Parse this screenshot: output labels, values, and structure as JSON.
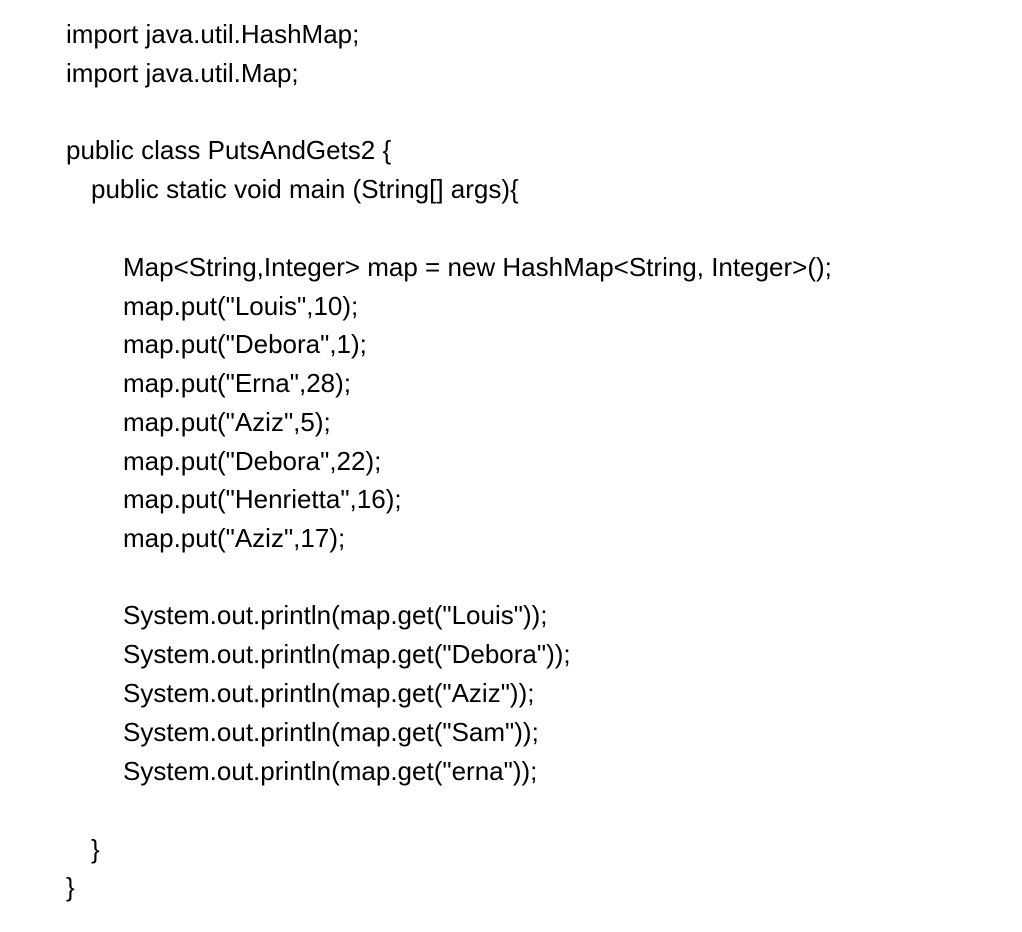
{
  "code": {
    "imports": [
      "import java.util.HashMap;",
      "import java.util.Map;"
    ],
    "class_decl": "public class PutsAndGets2 {",
    "method_decl": "public static void main (String[] args){",
    "map_decl": "Map<String,Integer> map = new HashMap<String, Integer>();",
    "puts": [
      "map.put(\"Louis\",10);",
      "map.put(\"Debora\",1);",
      "map.put(\"Erna\",28);",
      "map.put(\"Aziz\",5);",
      "map.put(\"Debora\",22);",
      "map.put(\"Henrietta\",16);",
      "map.put(\"Aziz\",17);"
    ],
    "prints": [
      "System.out.println(map.get(\"Louis\"));",
      "System.out.println(map.get(\"Debora\"));",
      "System.out.println(map.get(\"Aziz\"));",
      "System.out.println(map.get(\"Sam\"));",
      "System.out.println(map.get(\"erna\"));"
    ],
    "method_close": "}",
    "class_close": "}"
  }
}
